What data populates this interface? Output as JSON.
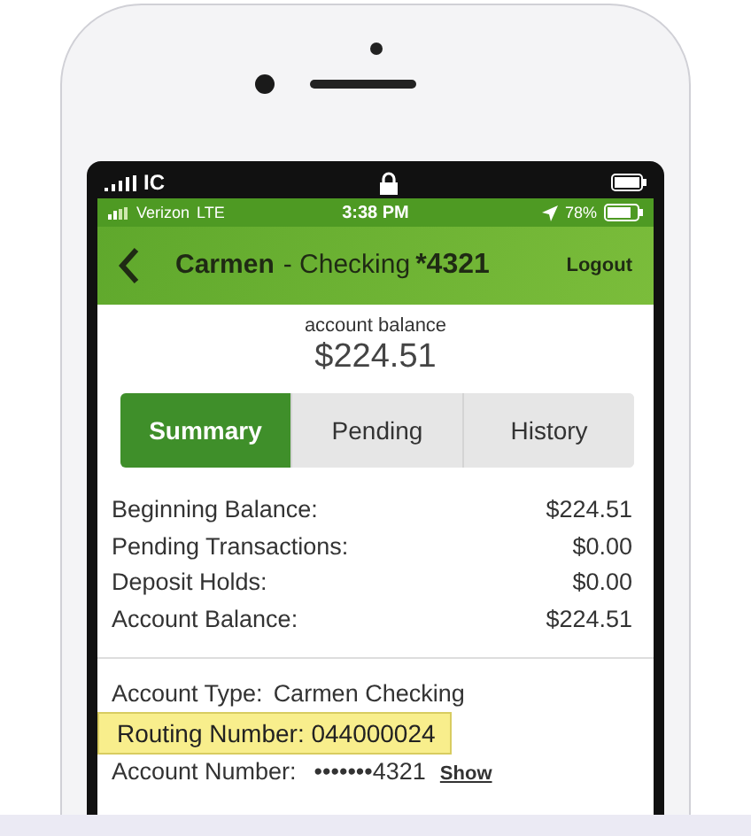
{
  "outer_status": {
    "carrier": "IC"
  },
  "status_bar": {
    "carrier": "Verizon",
    "network": "LTE",
    "time": "3:38 PM",
    "battery": "78%"
  },
  "header": {
    "name": "Carmen",
    "account": "- Checking",
    "suffix": "*4321",
    "logout": "Logout"
  },
  "balance": {
    "label": "account balance",
    "amount": "$224.51"
  },
  "tabs": [
    {
      "label": "Summary",
      "selected": true
    },
    {
      "label": "Pending",
      "selected": false
    },
    {
      "label": "History",
      "selected": false
    }
  ],
  "summary": [
    {
      "label": "Beginning Balance:",
      "value": "$224.51"
    },
    {
      "label": "Pending Transactions:",
      "value": "$0.00"
    },
    {
      "label": "Deposit Holds:",
      "value": "$0.00"
    },
    {
      "label": "Account Balance:",
      "value": "$224.51"
    }
  ],
  "details": {
    "type_label": "Account Type:",
    "type_value": "Carmen Checking",
    "routing": "Routing Number: 044000024",
    "number_label": "Account Number:",
    "number_masked": "•••••••4321",
    "show": "Show"
  }
}
